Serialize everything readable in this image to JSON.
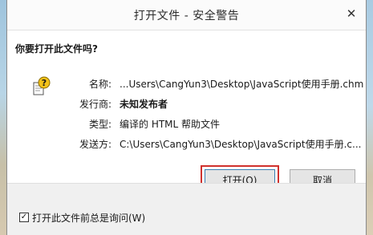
{
  "window": {
    "title": "打开文件 - 安全警告",
    "close_glyph": "✕"
  },
  "dialog": {
    "question": "你要打开此文件吗?",
    "fields": [
      {
        "label": "名称:",
        "value": "...Users\\CangYun3\\Desktop\\JavaScript使用手册.chm"
      },
      {
        "label": "发行商:",
        "value": "未知发布者"
      },
      {
        "label": "类型:",
        "value": "编译的 HTML 帮助文件"
      },
      {
        "label": "发送方:",
        "value": "C:\\Users\\CangYun3\\Desktop\\JavaScript使用手册.c..."
      }
    ]
  },
  "buttons": {
    "open_label": "打开(O)",
    "cancel_label": "取消"
  },
  "footer": {
    "checkbox_checked": true,
    "checkbox_glyph": "✓",
    "checkbox_label": "打开此文件前总是询问(W)"
  },
  "colors": {
    "highlight_border": "#d0312d",
    "default_button_border": "#3c7fb1"
  },
  "icons": {
    "warning": "file-warning-icon",
    "close": "close-icon"
  }
}
